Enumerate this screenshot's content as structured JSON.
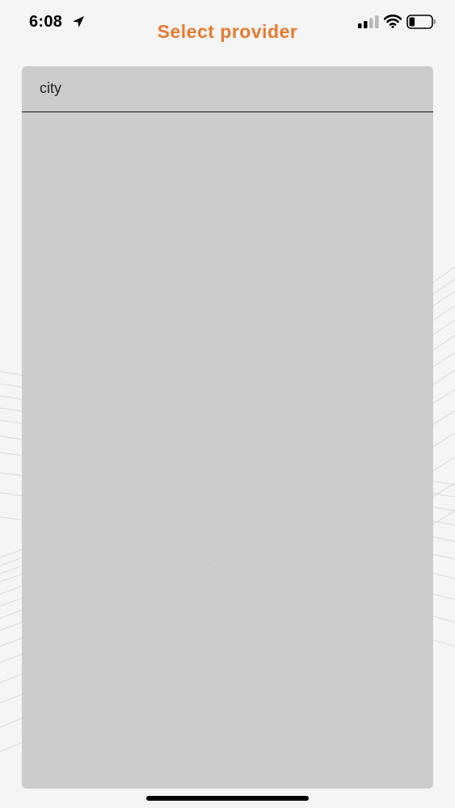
{
  "status_bar": {
    "time": "6:08",
    "location_icon": "location-arrow-icon",
    "signal_icon": "cellular-signal-icon",
    "wifi_icon": "wifi-icon",
    "battery_icon": "battery-icon",
    "battery_level": 0.25
  },
  "header": {
    "title": "Select provider"
  },
  "search": {
    "value": "city"
  },
  "colors": {
    "accent": "#e87a2e",
    "background": "#f5f5f6",
    "panel": "#c8c8cb"
  }
}
